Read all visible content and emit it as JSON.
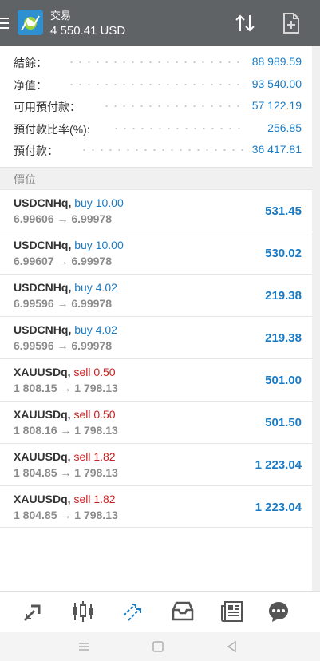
{
  "header": {
    "title": "交易",
    "balance": "4 550.41 USD"
  },
  "summary": [
    {
      "label": "結餘：",
      "value": "88 989.59"
    },
    {
      "label": "净值：",
      "value": "93 540.00"
    },
    {
      "label": "可用預付款：",
      "value": "57 122.19"
    },
    {
      "label": "預付款比率(%):",
      "value": "256.85"
    },
    {
      "label": "預付款：",
      "value": "36 417.81"
    }
  ],
  "section": {
    "title": "價位"
  },
  "positions": [
    {
      "symbol": "USDCNHq,",
      "direction": "buy",
      "volume": "buy 10.00",
      "prices": "6.99606 → 6.99978",
      "profit": "531.45"
    },
    {
      "symbol": "USDCNHq,",
      "direction": "buy",
      "volume": "buy 10.00",
      "prices": "6.99607 → 6.99978",
      "profit": "530.02"
    },
    {
      "symbol": "USDCNHq,",
      "direction": "buy",
      "volume": "buy 4.02",
      "prices": "6.99596 → 6.99978",
      "profit": "219.38"
    },
    {
      "symbol": "USDCNHq,",
      "direction": "buy",
      "volume": "buy 4.02",
      "prices": "6.99596 → 6.99978",
      "profit": "219.38"
    },
    {
      "symbol": "XAUUSDq,",
      "direction": "sell",
      "volume": "sell 0.50",
      "prices": "1 808.15 → 1 798.13",
      "profit": "501.00"
    },
    {
      "symbol": "XAUUSDq,",
      "direction": "sell",
      "volume": "sell 0.50",
      "prices": "1 808.16 → 1 798.13",
      "profit": "501.50"
    },
    {
      "symbol": "XAUUSDq,",
      "direction": "sell",
      "volume": "sell 1.82",
      "prices": "1 804.85 → 1 798.13",
      "profit": "1 223.04"
    },
    {
      "symbol": "XAUUSDq,",
      "direction": "sell",
      "volume": "sell 1.82",
      "prices": "1 804.85 → 1 798.13",
      "profit": "1 223.04"
    }
  ],
  "bottom_nav": [
    {
      "icon": "quotes-icon",
      "active": false
    },
    {
      "icon": "chart-icon",
      "active": false
    },
    {
      "icon": "trade-icon",
      "active": true
    },
    {
      "icon": "history-icon",
      "active": false
    },
    {
      "icon": "news-icon",
      "active": false
    },
    {
      "icon": "messages-icon",
      "active": false
    }
  ],
  "colors": {
    "header_bg": "#5f6366",
    "accent_blue": "#1a7bc4",
    "sell_red": "#c72020",
    "nav_gray": "#555555"
  }
}
